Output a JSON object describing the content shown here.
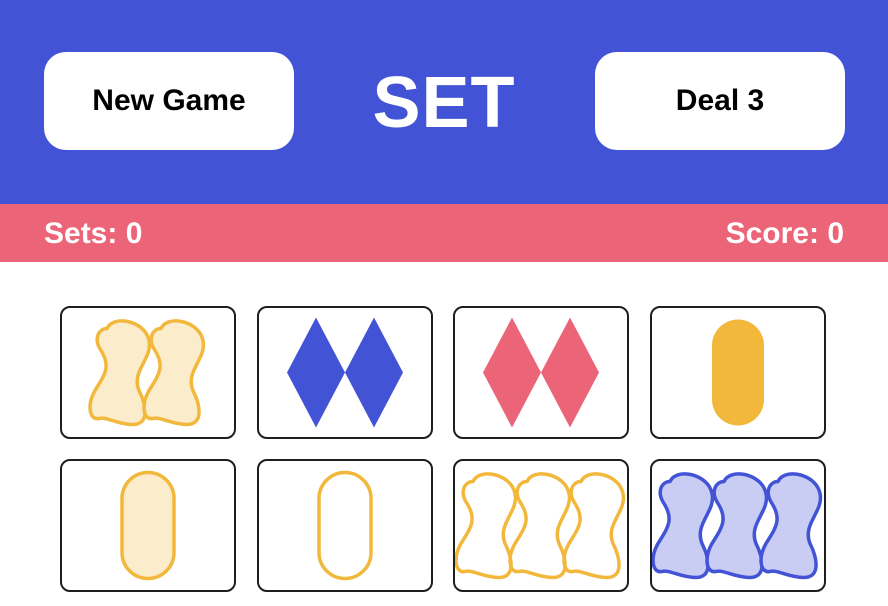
{
  "header": {
    "new_game_label": "New Game",
    "title": "SET",
    "deal_label": "Deal 3",
    "background": "#4353d6"
  },
  "status": {
    "sets_label": "Sets: 0",
    "score_label": "Score: 0",
    "background": "#ec6477"
  },
  "colors": {
    "yellow": "#f2b83c",
    "blue": "#4353d6",
    "red": "#ec6477"
  },
  "cards": [
    {
      "count": 2,
      "shape": "squiggle",
      "color": "yellow",
      "fill": "striped"
    },
    {
      "count": 2,
      "shape": "diamond",
      "color": "blue",
      "fill": "solid"
    },
    {
      "count": 2,
      "shape": "diamond",
      "color": "red",
      "fill": "solid"
    },
    {
      "count": 1,
      "shape": "oval",
      "color": "yellow",
      "fill": "solid"
    },
    {
      "count": 1,
      "shape": "oval",
      "color": "yellow",
      "fill": "striped"
    },
    {
      "count": 1,
      "shape": "oval",
      "color": "yellow",
      "fill": "open"
    },
    {
      "count": 3,
      "shape": "squiggle",
      "color": "yellow",
      "fill": "open"
    },
    {
      "count": 3,
      "shape": "squiggle",
      "color": "blue",
      "fill": "striped"
    }
  ]
}
